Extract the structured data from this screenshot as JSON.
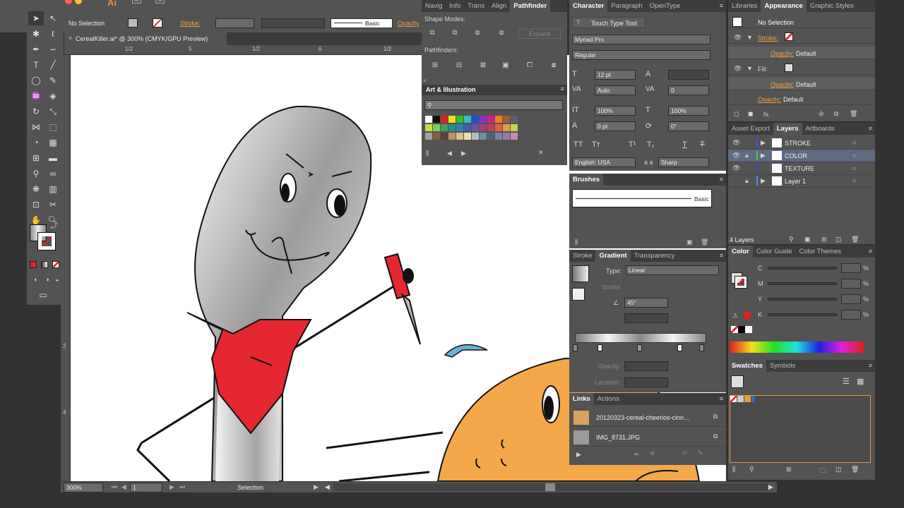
{
  "app": {
    "logo": "Ai",
    "launcher_1": "Br",
    "launcher_2": "St"
  },
  "control_bar": {
    "selection": "No Selection",
    "stroke_label": "Stroke:",
    "stroke_style": "Basic",
    "opacity_label": "Opacity"
  },
  "document": {
    "tab_title": "CerealKiller.ai* @ 300% (CMYK/GPU Preview)",
    "ruler_marks": [
      "1/2",
      "5",
      "1/2",
      "6",
      "1/2"
    ],
    "vruler_marks": [
      "2",
      "4"
    ]
  },
  "status_bar": {
    "zoom": "300%",
    "artboard": "1",
    "tool": "Selection"
  },
  "pathfinder": {
    "tabs": [
      "Navig",
      "Info",
      "Trans",
      "Align",
      "Pathfinder"
    ],
    "shape_modes": "Shape Modes:",
    "expand": "Expand",
    "pathfinders": "Pathfinders:"
  },
  "art_illustration": {
    "title": "Art & Illustration"
  },
  "character": {
    "tabs": [
      "Character",
      "Paragraph",
      "OpenType"
    ],
    "tool": "Touch Type Tool",
    "font": "Myriad Pro",
    "style": "Regular",
    "size": "12 pt",
    "leading": "",
    "kerning": "Auto",
    "tracking": "0",
    "vscale": "100%",
    "hscale": "100%",
    "baseline": "0 pt",
    "rotation": "0°",
    "language": "English: USA",
    "aa_label": "a a",
    "antialias": "Sharp"
  },
  "brushes": {
    "title": "Brushes",
    "basic": "Basic"
  },
  "gradient": {
    "tabs": [
      "Stroke",
      "Gradient",
      "Transparency"
    ],
    "type_label": "Type:",
    "type": "Linear",
    "stroke_label": "Stroke:",
    "angle": "45°",
    "opacity_label": "Opacity:",
    "location_label": "Location:"
  },
  "links": {
    "tabs": [
      "Links",
      "Actions"
    ],
    "items": [
      "20120323-cereal-cheerios-cinn...",
      "IMG_8731.JPG"
    ]
  },
  "appearance": {
    "tabs": [
      "Libraries",
      "Appearance",
      "Graphic Styles"
    ],
    "title": "No Selection",
    "stroke": "Stroke:",
    "opacity1": "Opacity:",
    "default1": "Default",
    "fill": "Fill:",
    "opacity2": "Opacity:",
    "default2": "Default",
    "opacity3": "Opacity:",
    "default3": "Default",
    "fx": "fx."
  },
  "layers": {
    "tabs": [
      "Asset Export",
      "Layers",
      "Artboards"
    ],
    "items": [
      {
        "name": "STROKE",
        "color": "#4a4aff"
      },
      {
        "name": "COLOR",
        "color": "#4bc54b"
      },
      {
        "name": "TEXTURE",
        "color": "#3d3de0"
      },
      {
        "name": "Layer 1",
        "color": "#4b8cff"
      }
    ],
    "count": "4 Layers"
  },
  "color": {
    "tabs": [
      "Color",
      "Color Guide",
      "Color Themes"
    ],
    "channels": [
      "C",
      "M",
      "Y",
      "K"
    ],
    "unit": "%"
  },
  "swatches": {
    "tabs": [
      "Swatches",
      "Symbols"
    ]
  }
}
